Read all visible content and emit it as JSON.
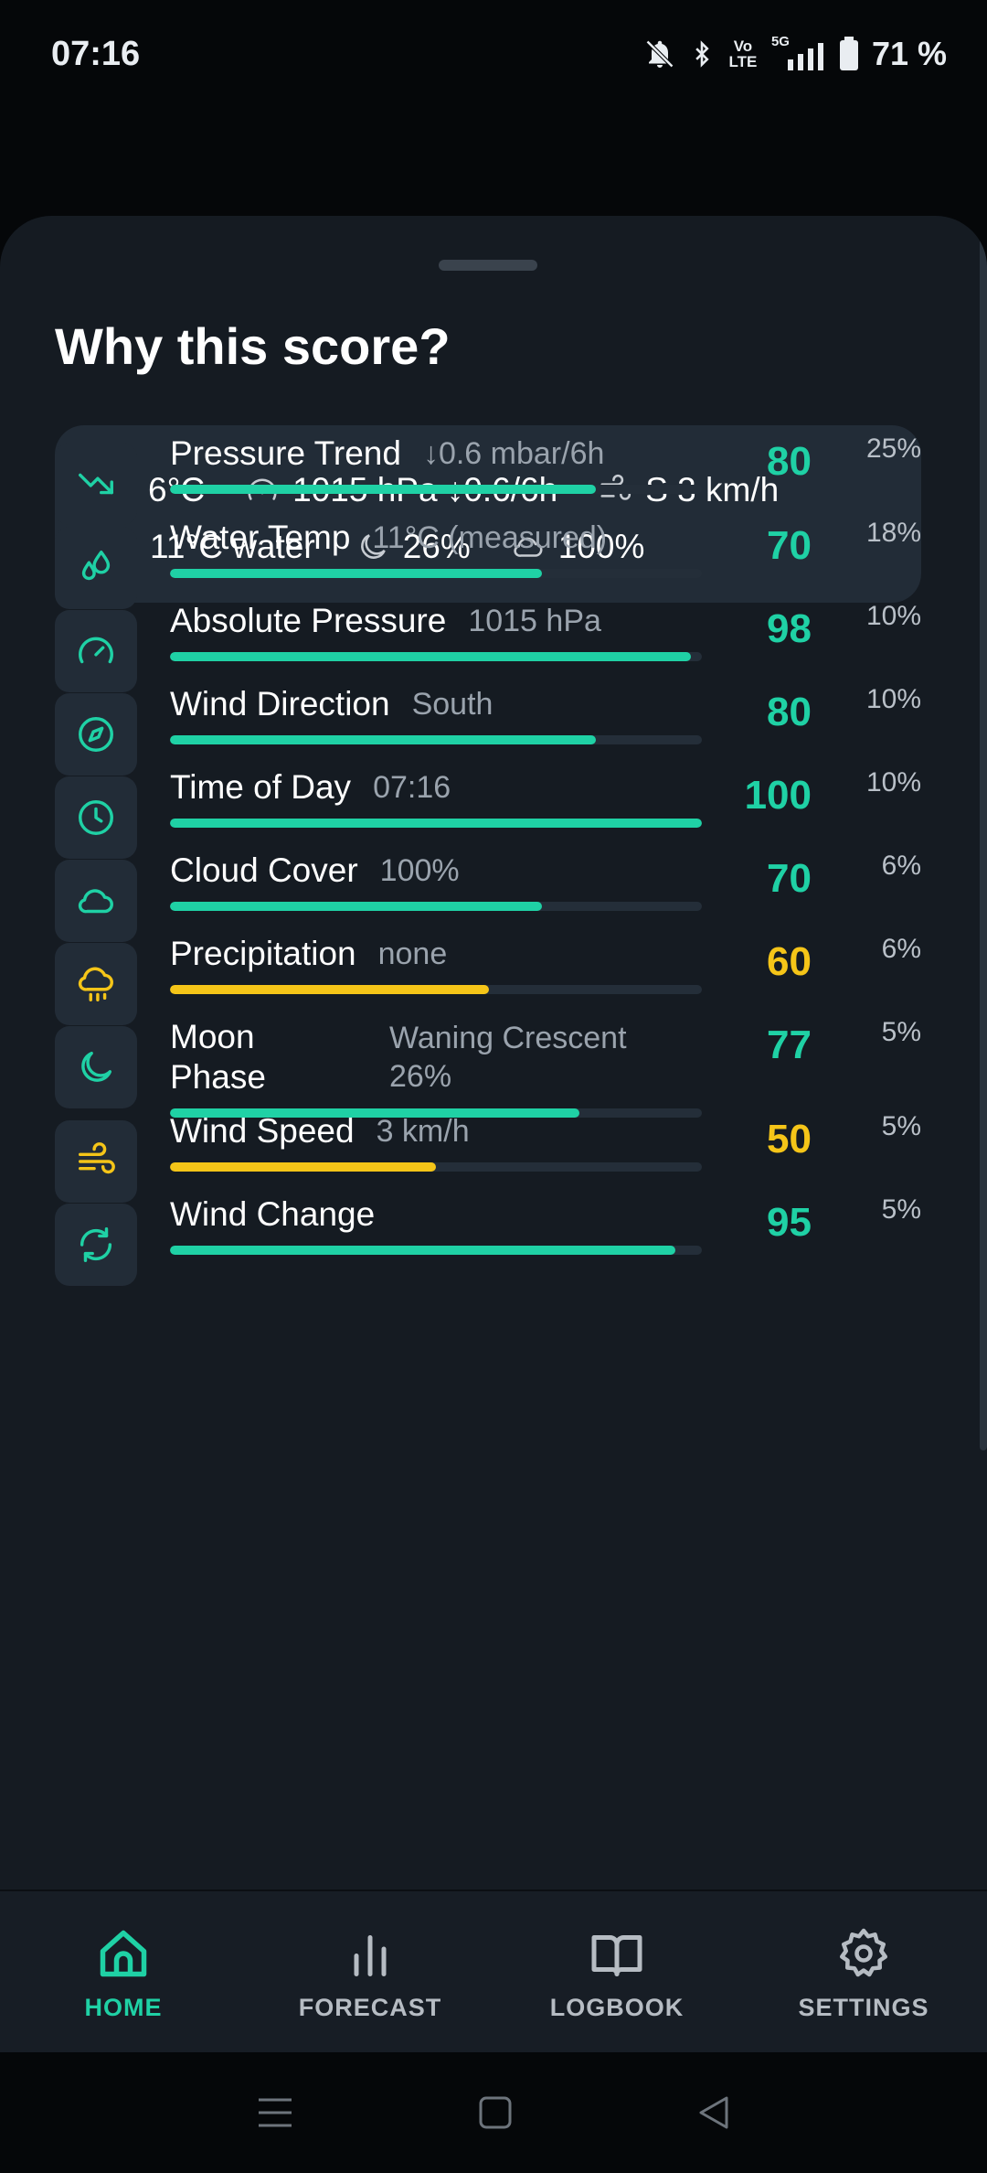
{
  "status_bar": {
    "time": "07:16",
    "battery": "71 %",
    "network": "5G",
    "volte": "Vo LTE"
  },
  "sheet": {
    "title": "Why this score?"
  },
  "conditions": {
    "air_temp": "6°C",
    "pressure": "1015 hPa ↓0.6/6h",
    "wind": "S 3 km/h",
    "water_temp": "11°C water",
    "moon": "26%",
    "clouds": "100%"
  },
  "colors": {
    "accent": "#1fd1a5",
    "warning": "#f5c518"
  },
  "factors": [
    {
      "name": "Pressure Trend",
      "detail": "↓0.6 mbar/6h",
      "score": "80",
      "weight": "25%",
      "level": 0.8,
      "color": "#1fd1a5",
      "icon": "trend-down-icon"
    },
    {
      "name": "Water Temp",
      "detail": "11°C (measured)",
      "score": "70",
      "weight": "18%",
      "level": 0.7,
      "color": "#1fd1a5",
      "icon": "water-drops-icon"
    },
    {
      "name": "Absolute Pressure",
      "detail": "1015 hPa",
      "score": "98",
      "weight": "10%",
      "level": 0.98,
      "color": "#1fd1a5",
      "icon": "gauge-icon"
    },
    {
      "name": "Wind Direction",
      "detail": "South",
      "score": "80",
      "weight": "10%",
      "level": 0.8,
      "color": "#1fd1a5",
      "icon": "compass-icon"
    },
    {
      "name": "Time of Day",
      "detail": "07:16",
      "score": "100",
      "weight": "10%",
      "level": 1.0,
      "color": "#1fd1a5",
      "icon": "clock-icon"
    },
    {
      "name": "Cloud Cover",
      "detail": "100%",
      "score": "70",
      "weight": "6%",
      "level": 0.7,
      "color": "#1fd1a5",
      "icon": "cloud-icon"
    },
    {
      "name": "Precipitation",
      "detail": "none",
      "score": "60",
      "weight": "6%",
      "level": 0.6,
      "color": "#f5c518",
      "icon": "cloud-rain-icon"
    },
    {
      "name": "Moon Phase",
      "detail": "Waning Crescent 26%",
      "score": "77",
      "weight": "5%",
      "level": 0.77,
      "color": "#1fd1a5",
      "icon": "moon-icon"
    },
    {
      "name": "Wind Speed",
      "detail": "3 km/h",
      "score": "50",
      "weight": "5%",
      "level": 0.5,
      "color": "#f5c518",
      "icon": "wind-icon"
    },
    {
      "name": "Wind Change",
      "detail": "",
      "score": "95",
      "weight": "5%",
      "level": 0.95,
      "color": "#1fd1a5",
      "icon": "refresh-icon"
    }
  ],
  "nav": {
    "home": "HOME",
    "forecast": "FORECAST",
    "logbook": "LOGBOOK",
    "settings": "SETTINGS",
    "active": "home"
  }
}
